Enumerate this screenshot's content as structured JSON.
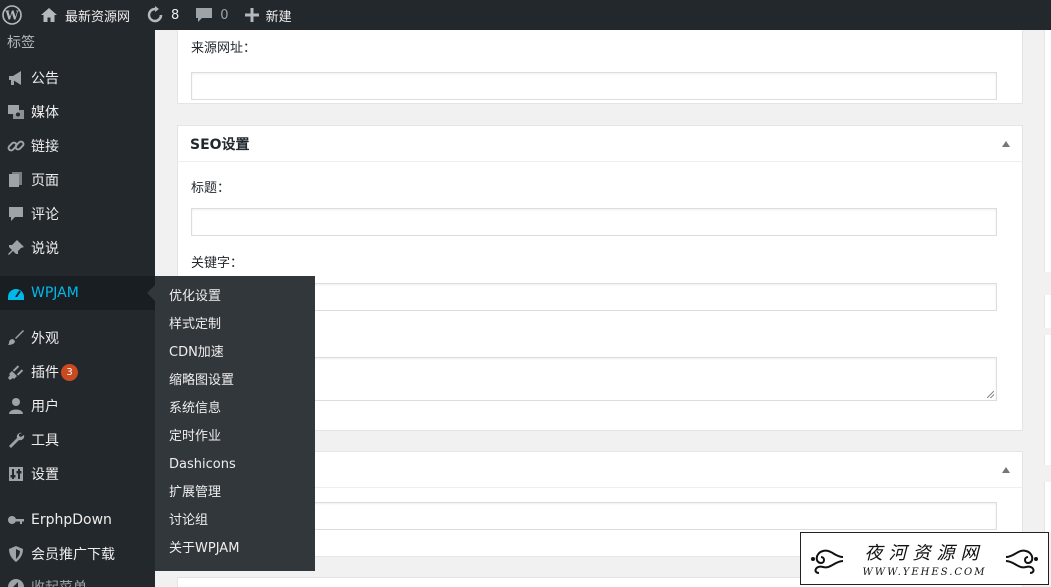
{
  "adminbar": {
    "site_name": "最新资源网",
    "updates_count": "8",
    "comments_count": "0",
    "new_label": "新建"
  },
  "sidebar": {
    "top_label": "标签",
    "items": [
      {
        "label": "公告",
        "icon": "megaphone-icon"
      },
      {
        "label": "媒体",
        "icon": "media-icon"
      },
      {
        "label": "链接",
        "icon": "link-icon"
      },
      {
        "label": "页面",
        "icon": "page-icon"
      },
      {
        "label": "评论",
        "icon": "comment-icon"
      },
      {
        "label": "说说",
        "icon": "pin-icon"
      },
      {
        "label": "WPJAM",
        "icon": "dashboard-icon"
      },
      {
        "label": "外观",
        "icon": "brush-icon"
      },
      {
        "label": "插件",
        "icon": "plugin-icon",
        "badge": "3"
      },
      {
        "label": "用户",
        "icon": "user-icon"
      },
      {
        "label": "工具",
        "icon": "wrench-icon"
      },
      {
        "label": "设置",
        "icon": "settings-icon"
      },
      {
        "label": "ErphpDown",
        "icon": "key-icon"
      },
      {
        "label": "会员推广下载",
        "icon": "shield-icon"
      },
      {
        "label": "收起菜单",
        "icon": "collapse-icon"
      }
    ]
  },
  "flyout": {
    "items": [
      "优化设置",
      "样式定制",
      "CDN加速",
      "缩略图设置",
      "系统信息",
      "定时作业",
      "Dashicons",
      "扩展管理",
      "讨论组",
      "关于WPJAM"
    ]
  },
  "main": {
    "top_box_label": "来源网址：",
    "seo_box": {
      "title": "SEO设置",
      "title_label": "标题：",
      "keywords_label": "关键字："
    }
  },
  "watermark": {
    "title": "夜河资源网",
    "subtitle": "WWW.YEHES.COM"
  },
  "colors": {
    "adminbar_bg": "#23282d",
    "active_accent": "#00b9eb",
    "badge": "#ca4a1f",
    "flyout_bg": "#32373c"
  }
}
